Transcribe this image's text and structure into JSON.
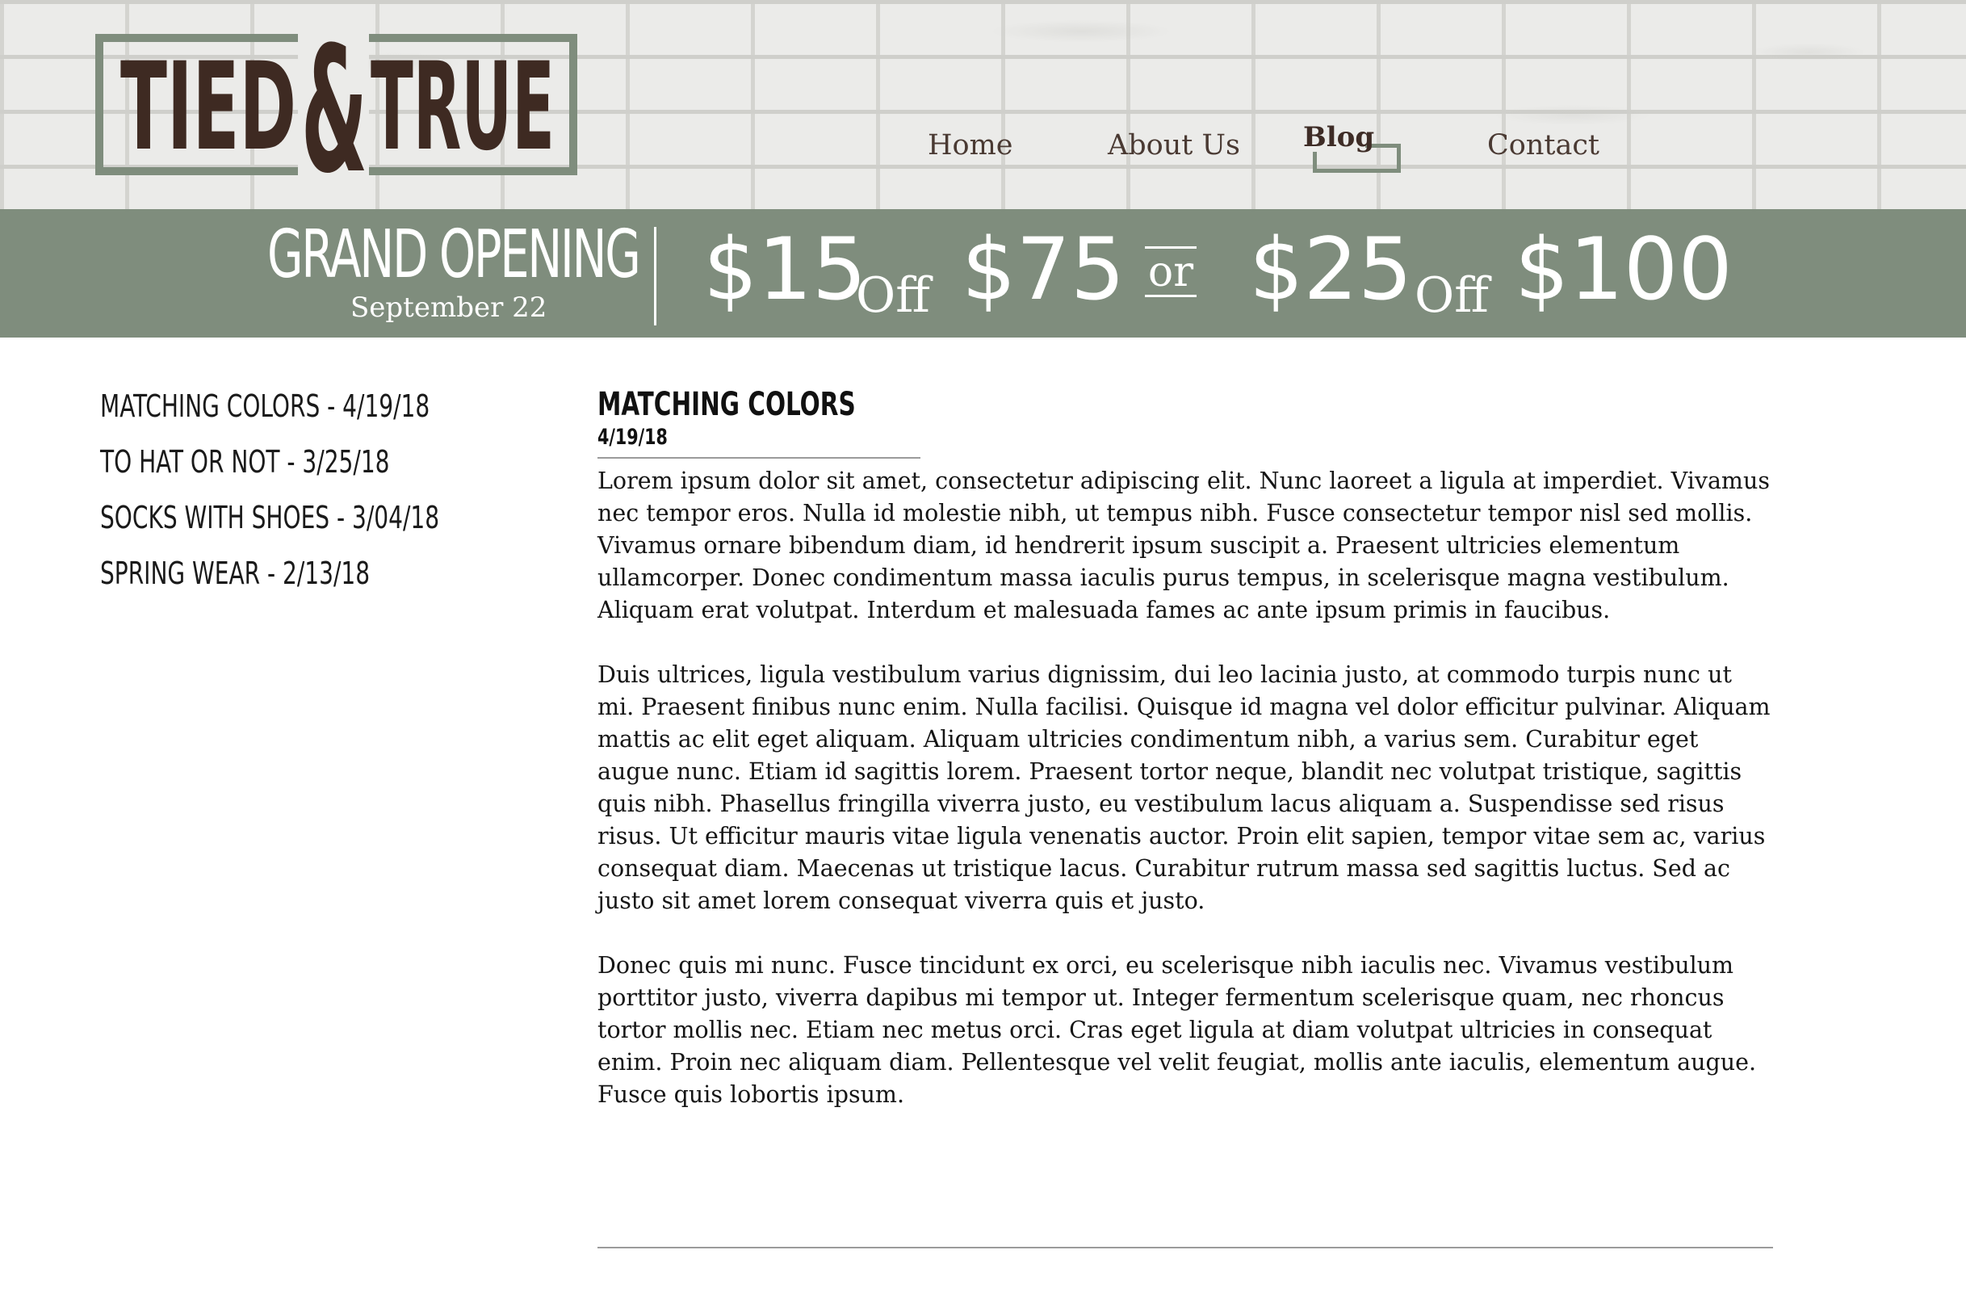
{
  "brand": {
    "logo_text_left": "TIED",
    "logo_text_ampersand": "&",
    "logo_text_right": "TRUE",
    "logo_border_color": "#7f8d7d",
    "logo_text_color": "#3e2a22"
  },
  "nav": {
    "items": [
      {
        "label": "Home"
      },
      {
        "label": "About Us"
      },
      {
        "label": "Blog",
        "active": true
      },
      {
        "label": "Contact"
      }
    ]
  },
  "banner": {
    "title": "GRAND OPENING",
    "date": "September 22",
    "offer1_amount": "$15",
    "offer1_off": "Off",
    "offer1_threshold": "$75",
    "or": "or",
    "offer2_amount": "$25",
    "offer2_off": "Off",
    "offer2_threshold": "$100",
    "background_color": "#7f8d7d"
  },
  "sidebar": {
    "posts": [
      {
        "label": "Matching Colors - 4/19/18"
      },
      {
        "label": "To Hat Or Not - 3/25/18"
      },
      {
        "label": "Socks With Shoes - 3/04/18"
      },
      {
        "label": "Spring Wear - 2/13/18"
      }
    ]
  },
  "article": {
    "title": "Matching Colors",
    "date": "4/19/18",
    "paragraphs": [
      "Lorem ipsum dolor sit amet, consectetur adipiscing elit. Nunc laoreet a ligula at imperdiet. Vivamus nec tempor eros. Nulla id molestie nibh, ut tempus nibh. Fusce consectetur tempor nisl sed mollis. Vivamus ornare bibendum diam, id hendrerit ipsum suscipit a. Praesent ultricies elementum ullamcorper. Donec condimentum massa iaculis purus tempus, in scelerisque magna vestibulum. Aliquam erat volutpat. Interdum et malesuada fames ac ante ipsum primis in faucibus.",
      "Duis ultrices, ligula vestibulum varius dignissim, dui leo lacinia justo, at commodo turpis nunc ut mi. Praesent finibus nunc enim. Nulla facilisi. Quisque id magna vel dolor efficitur pulvinar. Aliquam mattis ac elit eget aliquam. Aliquam ultricies condimentum nibh, a varius sem. Curabitur eget augue nunc. Etiam id sagittis lorem. Praesent tortor neque, blandit nec volutpat tristique, sagittis quis nibh. Phasellus fringilla viverra justo, eu vestibulum lacus aliquam a. Suspendisse sed risus risus. Ut efficitur mauris vitae ligula venenatis auctor. Proin elit sapien, tempor vitae sem ac, varius consequat diam. Maecenas ut tristique lacus. Curabitur rutrum massa sed sagittis luctus. Sed ac justo sit amet lorem consequat viverra quis et justo.",
      "Donec quis mi nunc. Fusce tincidunt ex orci, eu scelerisque nibh iaculis nec. Vivamus vestibulum porttitor justo, viverra dapibus mi tempor ut. Integer fermentum scelerisque quam, nec rhoncus tortor mollis nec. Etiam nec metus orci. Cras eget ligula at diam volutpat ultricies in consequat enim. Proin nec aliquam diam. Pellentesque vel velit feugiat, mollis ante iaculis, elementum augue. Fusce quis lobortis ipsum."
    ]
  }
}
